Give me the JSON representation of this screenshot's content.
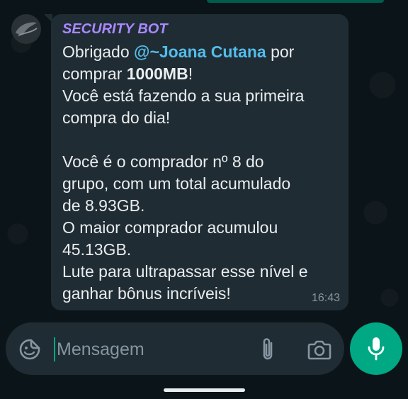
{
  "message": {
    "sender": "SECURITY BOT",
    "line1_prefix": "Obrigado ",
    "mention": "@~Joana Cutana",
    "line1_suffix": " por",
    "line2_prefix": "comprar ",
    "amount": "1000MB",
    "line2_suffix": "!",
    "line3": "Você está fazendo a sua primeira",
    "line4": "compra do dia!",
    "line5": "Você é o comprador nº 8 do",
    "line6": "grupo, com um total acumulado",
    "line7": "de 8.93GB.",
    "line8": "O maior comprador acumulou",
    "line9": "45.13GB.",
    "line10": "Lute para ultrapassar esse nível e",
    "line11": "ganhar bônus incríveis!",
    "time": "16:43"
  },
  "composer": {
    "placeholder": "Mensagem"
  },
  "icons": {
    "sticker": "sticker-icon",
    "attach": "paperclip-icon",
    "camera": "camera-icon",
    "mic": "microphone-icon",
    "avatar": "bot-avatar"
  },
  "colors": {
    "background": "#0b1418",
    "bubble": "#202c33",
    "sender": "#a989ff",
    "mention": "#53bdeb",
    "accent": "#00a884"
  }
}
